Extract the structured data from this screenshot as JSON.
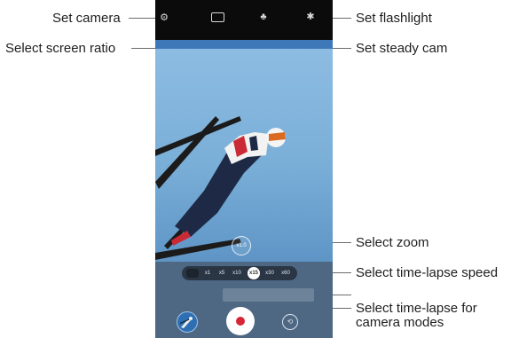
{
  "callouts": {
    "set_camera": "Set camera",
    "select_screen_ratio": "Select screen ratio",
    "set_flashlight": "Set flashlight",
    "set_steady_cam": "Set steady cam",
    "select_zoom": "Select zoom",
    "select_time_lapse_speed": "Select time-lapse speed",
    "select_time_lapse_modes": "Select time-lapse for camera modes"
  },
  "camera": {
    "icons": {
      "settings": "gear-icon",
      "ratio": "aspect-ratio-icon",
      "steady_cam": "steady-cam-icon",
      "flash": "flash-icon",
      "zoom": "zoom-icon",
      "switch": "switch-camera-icon",
      "record": "record-icon"
    },
    "zoom_label": "x1.0",
    "speeds": [
      "x1",
      "x5",
      "x10",
      "x15",
      "x30",
      "x60"
    ],
    "selected_speed": "x15"
  },
  "colors": {
    "record": "#d72638",
    "sky": "#8fbde3",
    "bottom_panel": "#4e6884"
  }
}
